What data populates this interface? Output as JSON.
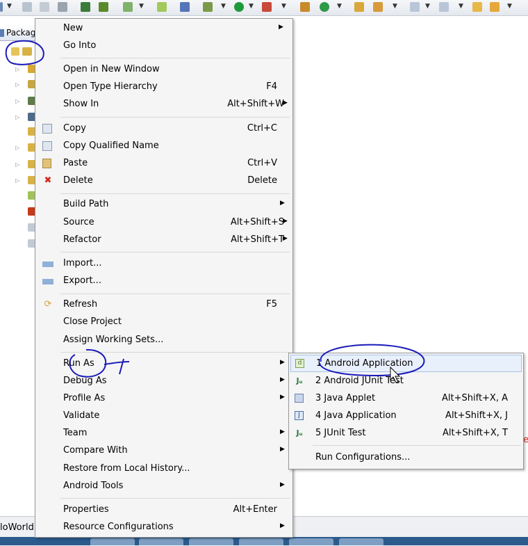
{
  "explorer": {
    "tab_label": "Packag"
  },
  "editor": {
    "bottom_label": "loWorld"
  },
  "context_menu": {
    "items": [
      {
        "label": "New",
        "shortcut": "",
        "submenu": true
      },
      {
        "label": "Go Into",
        "shortcut": "",
        "submenu": false
      },
      {
        "label": "Open in New Window",
        "shortcut": "",
        "submenu": false
      },
      {
        "label": "Open Type Hierarchy",
        "shortcut": "F4",
        "submenu": false
      },
      {
        "label": "Show In",
        "shortcut": "Alt+Shift+W",
        "submenu": true
      },
      {
        "label": "Copy",
        "shortcut": "Ctrl+C",
        "submenu": false,
        "icon": "copy-icon"
      },
      {
        "label": "Copy Qualified Name",
        "shortcut": "",
        "submenu": false,
        "icon": "copy-qualified-icon"
      },
      {
        "label": "Paste",
        "shortcut": "Ctrl+V",
        "submenu": false,
        "icon": "paste-icon"
      },
      {
        "label": "Delete",
        "shortcut": "Delete",
        "submenu": false,
        "icon": "delete-icon"
      },
      {
        "label": "Build Path",
        "shortcut": "",
        "submenu": true
      },
      {
        "label": "Source",
        "shortcut": "Alt+Shift+S",
        "submenu": true
      },
      {
        "label": "Refactor",
        "shortcut": "Alt+Shift+T",
        "submenu": true
      },
      {
        "label": "Import...",
        "shortcut": "",
        "submenu": false,
        "icon": "import-icon"
      },
      {
        "label": "Export...",
        "shortcut": "",
        "submenu": false,
        "icon": "export-icon"
      },
      {
        "label": "Refresh",
        "shortcut": "F5",
        "submenu": false,
        "icon": "refresh-icon"
      },
      {
        "label": "Close Project",
        "shortcut": "",
        "submenu": false
      },
      {
        "label": "Assign Working Sets...",
        "shortcut": "",
        "submenu": false
      },
      {
        "label": "Run As",
        "shortcut": "",
        "submenu": true
      },
      {
        "label": "Debug As",
        "shortcut": "",
        "submenu": true
      },
      {
        "label": "Profile As",
        "shortcut": "",
        "submenu": true
      },
      {
        "label": "Validate",
        "shortcut": "",
        "submenu": false
      },
      {
        "label": "Team",
        "shortcut": "",
        "submenu": true
      },
      {
        "label": "Compare With",
        "shortcut": "",
        "submenu": true
      },
      {
        "label": "Restore from Local History...",
        "shortcut": "",
        "submenu": false
      },
      {
        "label": "Android Tools",
        "shortcut": "",
        "submenu": true
      },
      {
        "label": "Properties",
        "shortcut": "Alt+Enter",
        "submenu": false
      },
      {
        "label": "Resource Configurations",
        "shortcut": "",
        "submenu": true
      }
    ]
  },
  "run_as_submenu": {
    "items": [
      {
        "label": "1 Android Application",
        "shortcut": "",
        "icon": "android-app-icon",
        "highlighted": true
      },
      {
        "label": "2 Android JUnit Test",
        "shortcut": "",
        "icon": "junit-icon"
      },
      {
        "label": "3 Java Applet",
        "shortcut": "Alt+Shift+X, A",
        "icon": "java-applet-icon"
      },
      {
        "label": "4 Java Application",
        "shortcut": "Alt+Shift+X, J",
        "icon": "java-application-icon"
      },
      {
        "label": "5 JUnit Test",
        "shortcut": "Alt+Shift+X, T",
        "icon": "junit-test-icon"
      },
      {
        "label": "Run Configurations...",
        "shortcut": ""
      }
    ]
  },
  "colors": {
    "menu_bg": "#f5f5f5",
    "highlight": "#e8f0fb",
    "annotation": "#1a1ab8"
  }
}
